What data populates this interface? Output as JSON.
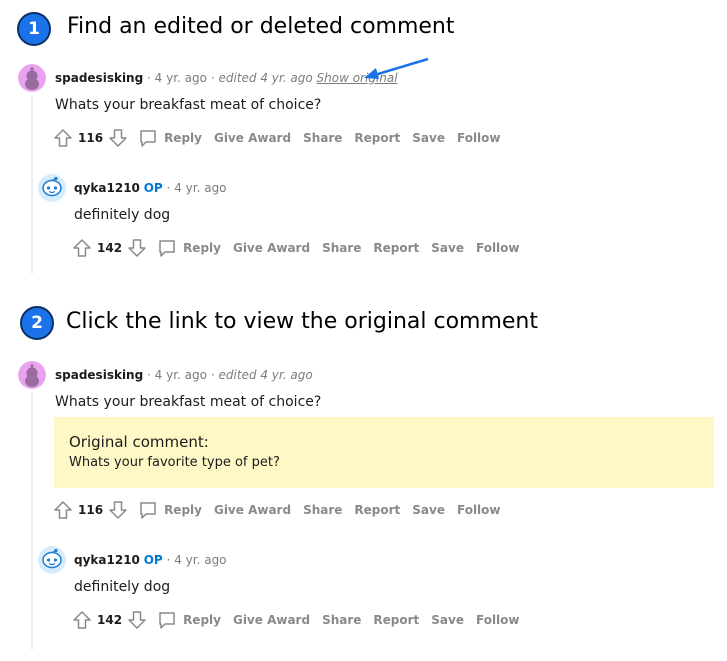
{
  "colors": {
    "badge": "#1a73e8",
    "arrow": "#1a73e8",
    "op": "#0079d3",
    "meta": "#7c7c7c",
    "original_bg": "#fdf8c6"
  },
  "steps": [
    {
      "number": "1",
      "title": "Find an edited or deleted comment",
      "comment": {
        "username": "spadesisking",
        "sep1": "·",
        "age": "4 yr. ago",
        "sep2": "·",
        "edited": "edited 4 yr. ago",
        "show_original": "Show original",
        "body": "Whats your breakfast meat of choice?",
        "score": "116",
        "actions": {
          "reply": "Reply",
          "give_award": "Give Award",
          "share": "Share",
          "report": "Report",
          "save": "Save",
          "follow": "Follow"
        }
      },
      "reply": {
        "username": "qyka1210",
        "op": "OP",
        "sep1": "·",
        "age": "4 yr. ago",
        "body": "definitely dog",
        "score": "142",
        "actions": {
          "reply": "Reply",
          "give_award": "Give Award",
          "share": "Share",
          "report": "Report",
          "save": "Save",
          "follow": "Follow"
        }
      },
      "annotation_icon": "pointer-arrow-icon"
    },
    {
      "number": "2",
      "title": "Click the link to view the original comment",
      "comment": {
        "username": "spadesisking",
        "sep1": "·",
        "age": "4 yr. ago",
        "sep2": "·",
        "edited": "edited 4 yr. ago",
        "body": "Whats your breakfast meat of choice?",
        "original_title": "Original comment:",
        "original_text": "Whats your favorite type of pet?",
        "score": "116",
        "actions": {
          "reply": "Reply",
          "give_award": "Give Award",
          "share": "Share",
          "report": "Report",
          "save": "Save",
          "follow": "Follow"
        }
      },
      "reply": {
        "username": "qyka1210",
        "op": "OP",
        "sep1": "·",
        "age": "4 yr. ago",
        "body": "definitely dog",
        "score": "142",
        "actions": {
          "reply": "Reply",
          "give_award": "Give Award",
          "share": "Share",
          "report": "Report",
          "save": "Save",
          "follow": "Follow"
        }
      }
    }
  ]
}
